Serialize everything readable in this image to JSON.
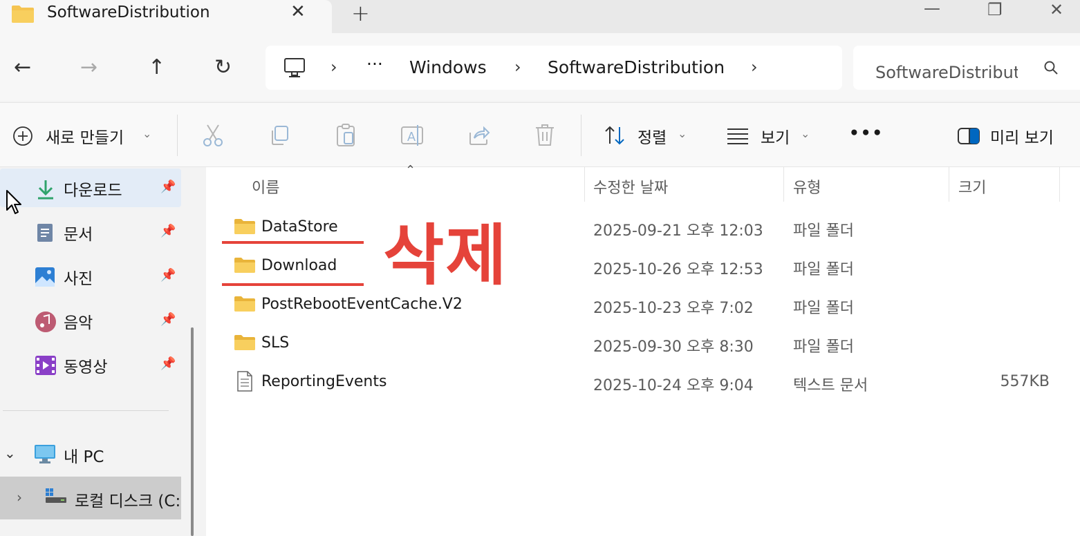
{
  "window": {
    "tab_title": "SoftwareDistribution",
    "tab_close": "✕",
    "tab_add": "+",
    "minimize": "—",
    "maximize": "❐",
    "close": "✕"
  },
  "nav": {
    "back": "←",
    "forward": "→",
    "up": "↑",
    "refresh": "↻",
    "more": "···",
    "chevron": "›",
    "breadcrumbs": [
      "Windows",
      "SoftwareDistribution"
    ],
    "search_placeholder": "SoftwareDistribution 검색"
  },
  "toolbar": {
    "new_label": "새로 만들기",
    "sort_label": "정렬",
    "view_label": "보기",
    "more": "•••",
    "preview_label": "미리 보기"
  },
  "sidebar": {
    "quick_access": [
      {
        "label": "다운로드",
        "icon": "download-icon"
      },
      {
        "label": "문서",
        "icon": "documents-icon"
      },
      {
        "label": "사진",
        "icon": "pictures-icon"
      },
      {
        "label": "음악",
        "icon": "music-icon"
      },
      {
        "label": "동영상",
        "icon": "videos-icon"
      }
    ],
    "this_pc": "내 PC",
    "local_disk": "로컬 디스크 (C:)"
  },
  "columns": {
    "name": "이름",
    "date": "수정한 날짜",
    "type": "유형",
    "size": "크기"
  },
  "files": [
    {
      "name": "DataStore",
      "date": "2025-09-21 오후 12:03",
      "type": "파일 폴더",
      "size": "",
      "kind": "folder"
    },
    {
      "name": "Download",
      "date": "2025-10-26 오후 12:53",
      "type": "파일 폴더",
      "size": "",
      "kind": "folder"
    },
    {
      "name": "PostRebootEventCache.V2",
      "date": "2025-10-23 오후 7:02",
      "type": "파일 폴더",
      "size": "",
      "kind": "folder"
    },
    {
      "name": "SLS",
      "date": "2025-09-30 오후 8:30",
      "type": "파일 폴더",
      "size": "",
      "kind": "folder"
    },
    {
      "name": "ReportingEvents",
      "date": "2025-10-24 오후 9:04",
      "type": "텍스트 문서",
      "size": "557KB",
      "kind": "text"
    }
  ],
  "annotation": {
    "text": "삭제",
    "color": "#e5433a"
  },
  "colors": {
    "folder": "#f5c451",
    "accent": "#0067c0"
  }
}
